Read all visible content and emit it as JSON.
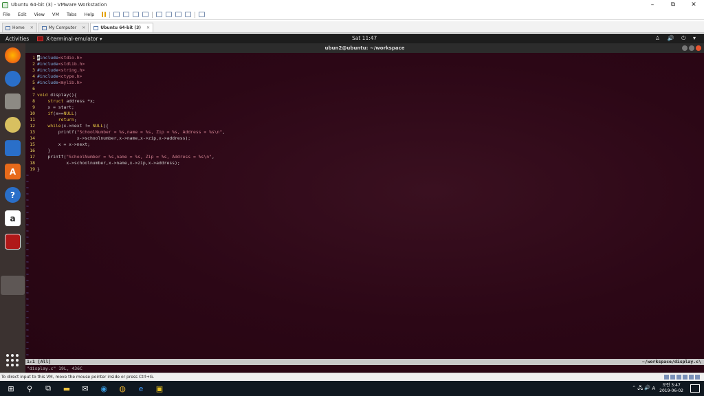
{
  "window": {
    "title": "Ubuntu 64-bit (3) - VMware Workstation",
    "controls": [
      "–",
      "⧉",
      "✕"
    ]
  },
  "menu": [
    "File",
    "Edit",
    "View",
    "VM",
    "Tabs",
    "Help"
  ],
  "tabs": [
    {
      "label": "Home"
    },
    {
      "label": "My Computer"
    },
    {
      "label": "Ubuntu 64-bit (3)"
    }
  ],
  "gnome": {
    "activities": "Activities",
    "app_menu": "X-terminal-emulator ▾",
    "clock": "Sat 11:47",
    "tray": "♙ 🔊 ⏻ ▾"
  },
  "terminal": {
    "title": "ubun2@ubuntu: ~/workspace"
  },
  "code": [
    {
      "n": "1",
      "t": "#include<stdio.h>"
    },
    {
      "n": "2",
      "t": "#include<stdlib.h>"
    },
    {
      "n": "3",
      "t": "#include<string.h>"
    },
    {
      "n": "4",
      "t": "#include<ctype.h>"
    },
    {
      "n": "5",
      "t": "#include<mylib.h>"
    },
    {
      "n": "6",
      "t": ""
    },
    {
      "n": "7",
      "t": "void display(){"
    },
    {
      "n": "8",
      "t": "    struct address *x;"
    },
    {
      "n": "9",
      "t": "    x = start;"
    },
    {
      "n": "10",
      "t": "    if(x==NULL)"
    },
    {
      "n": "11",
      "t": "        return;"
    },
    {
      "n": "12",
      "t": "    while(x->next != NULL){"
    },
    {
      "n": "13",
      "t": "        printf(\"SchoolNumber = %s,name = %s, Zip = %s, Address = %s\\n\","
    },
    {
      "n": "14",
      "t": "               x->schoolnumber,x->name,x->zip,x->address);"
    },
    {
      "n": "15",
      "t": "        x = x->next;"
    },
    {
      "n": "16",
      "t": "    }"
    },
    {
      "n": "17",
      "t": "    printf(\"SchoolNumber = %s,name = %s, Zip = %s, Address = %s\\n\","
    },
    {
      "n": "18",
      "t": "           x->schoolnumber,x->name,x->zip,x->address);"
    },
    {
      "n": "19",
      "t": "}"
    }
  ],
  "vim": {
    "status_left": "1:1 [All]",
    "status_right": "~/workspace/display.c\\",
    "cmdline": "\"display.c\" 19L, 436C"
  },
  "vm_status": "To direct input to this VM, move the mouse pointer inside or press Ctrl+G.",
  "taskbar": {
    "clock_time": "오전 3:47",
    "clock_date": "2019-06-02",
    "lang": "A"
  }
}
